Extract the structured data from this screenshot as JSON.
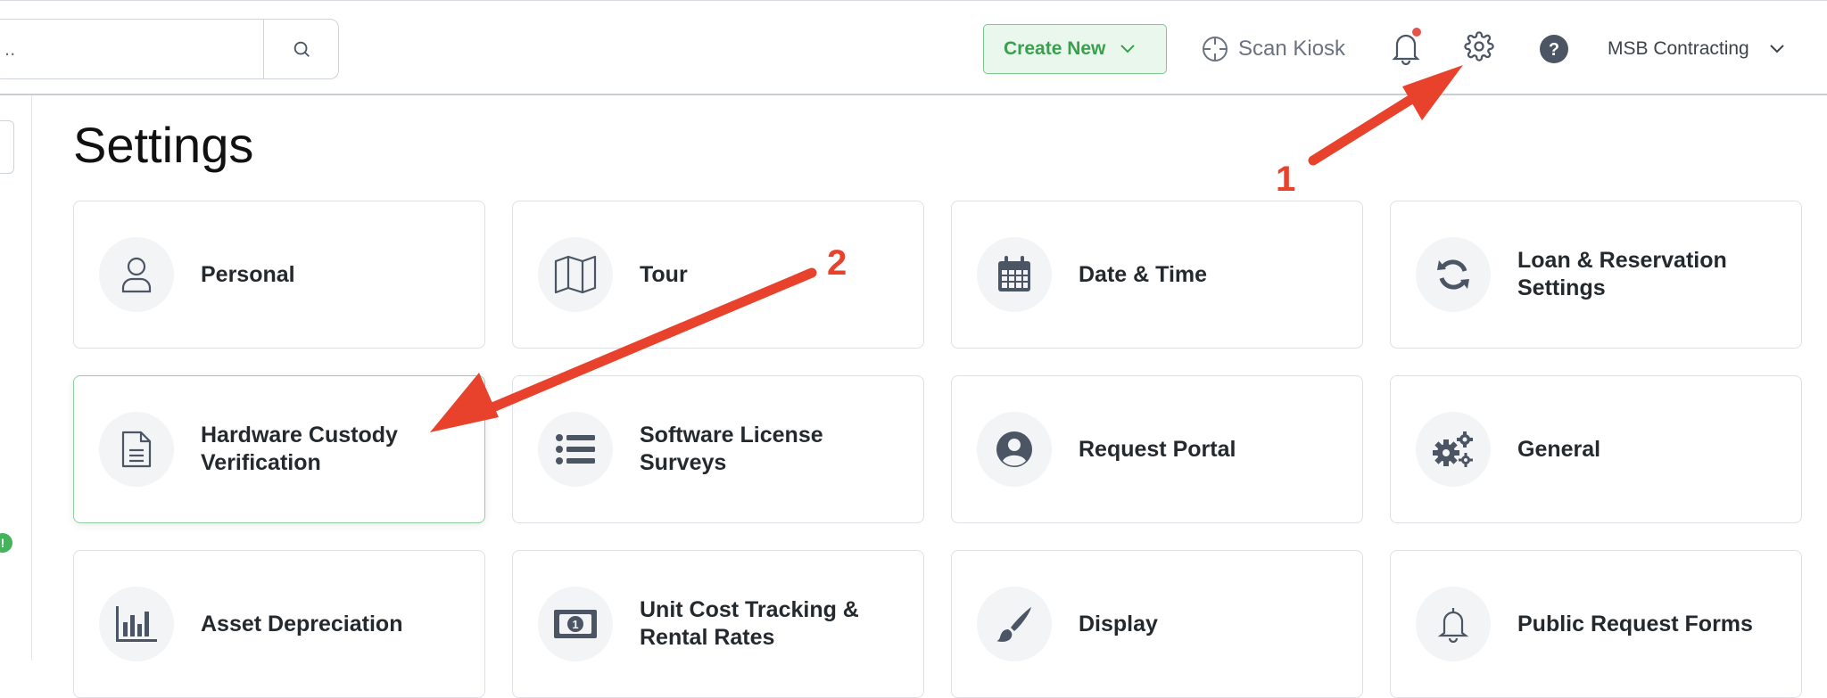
{
  "header": {
    "search_value": "..",
    "create_new_label": "Create New",
    "scan_kiosk_label": "Scan Kiosk",
    "account_name": "MSB Contracting",
    "notification_color": "#e5534b",
    "accent_color": "#3aa04f"
  },
  "sidebar": {
    "status_badge": "!"
  },
  "page": {
    "title": "Settings"
  },
  "cards": [
    {
      "label": "Personal",
      "icon": "user-icon"
    },
    {
      "label": "Tour",
      "icon": "map-icon"
    },
    {
      "label": "Date & Time",
      "icon": "calendar-icon"
    },
    {
      "label": "Loan & Reservation Settings",
      "icon": "sync-icon"
    },
    {
      "label": "Hardware Custody Verification",
      "icon": "document-icon",
      "active": true
    },
    {
      "label": "Software License Surveys",
      "icon": "list-icon"
    },
    {
      "label": "Request Portal",
      "icon": "user-circle-icon"
    },
    {
      "label": "General",
      "icon": "gears-icon"
    },
    {
      "label": "Asset Depreciation",
      "icon": "bar-chart-icon"
    },
    {
      "label": "Unit Cost Tracking & Rental Rates",
      "icon": "money-bill-icon"
    },
    {
      "label": "Display",
      "icon": "paint-brush-icon"
    },
    {
      "label": "Public Request Forms",
      "icon": "bell-icon"
    }
  ],
  "annotations": {
    "arrow_color": "#e8412c",
    "step_1": "1",
    "step_2": "2"
  }
}
